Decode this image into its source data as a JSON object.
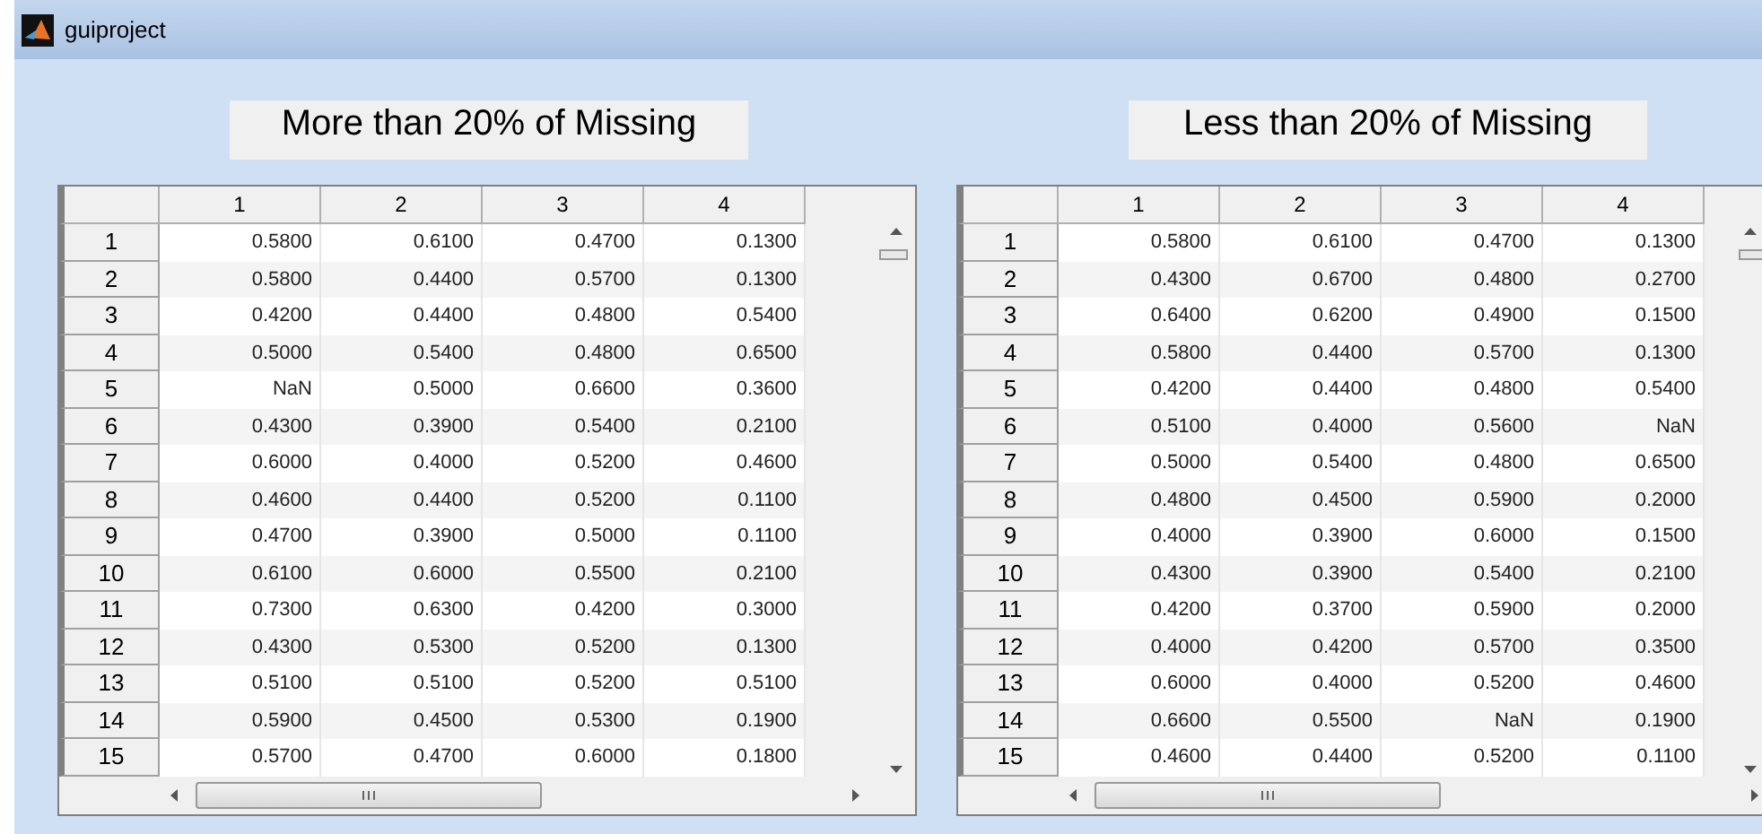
{
  "window": {
    "title": "guiproject"
  },
  "tables": [
    {
      "title": "More than 20% of Missing",
      "columns": [
        "1",
        "2",
        "3",
        "4"
      ],
      "rows": [
        {
          "label": "1",
          "cells": [
            "0.5800",
            "0.6100",
            "0.4700",
            "0.1300"
          ]
        },
        {
          "label": "2",
          "cells": [
            "0.5800",
            "0.4400",
            "0.5700",
            "0.1300"
          ]
        },
        {
          "label": "3",
          "cells": [
            "0.4200",
            "0.4400",
            "0.4800",
            "0.5400"
          ]
        },
        {
          "label": "4",
          "cells": [
            "0.5000",
            "0.5400",
            "0.4800",
            "0.6500"
          ]
        },
        {
          "label": "5",
          "cells": [
            "NaN",
            "0.5000",
            "0.6600",
            "0.3600"
          ]
        },
        {
          "label": "6",
          "cells": [
            "0.4300",
            "0.3900",
            "0.5400",
            "0.2100"
          ]
        },
        {
          "label": "7",
          "cells": [
            "0.6000",
            "0.4000",
            "0.5200",
            "0.4600"
          ]
        },
        {
          "label": "8",
          "cells": [
            "0.4600",
            "0.4400",
            "0.5200",
            "0.1100"
          ]
        },
        {
          "label": "9",
          "cells": [
            "0.4700",
            "0.3900",
            "0.5000",
            "0.1100"
          ]
        },
        {
          "label": "10",
          "cells": [
            "0.6100",
            "0.6000",
            "0.5500",
            "0.2100"
          ]
        },
        {
          "label": "11",
          "cells": [
            "0.7300",
            "0.6300",
            "0.4200",
            "0.3000"
          ]
        },
        {
          "label": "12",
          "cells": [
            "0.4300",
            "0.5300",
            "0.5200",
            "0.1300"
          ]
        },
        {
          "label": "13",
          "cells": [
            "0.5100",
            "0.5100",
            "0.5200",
            "0.5100"
          ]
        },
        {
          "label": "14",
          "cells": [
            "0.5900",
            "0.4500",
            "0.5300",
            "0.1900"
          ]
        },
        {
          "label": "15",
          "cells": [
            "0.5700",
            "0.4700",
            "0.6000",
            "0.1800"
          ]
        }
      ]
    },
    {
      "title": "Less than 20% of Missing",
      "columns": [
        "1",
        "2",
        "3",
        "4"
      ],
      "rows": [
        {
          "label": "1",
          "cells": [
            "0.5800",
            "0.6100",
            "0.4700",
            "0.1300"
          ]
        },
        {
          "label": "2",
          "cells": [
            "0.4300",
            "0.6700",
            "0.4800",
            "0.2700"
          ]
        },
        {
          "label": "3",
          "cells": [
            "0.6400",
            "0.6200",
            "0.4900",
            "0.1500"
          ]
        },
        {
          "label": "4",
          "cells": [
            "0.5800",
            "0.4400",
            "0.5700",
            "0.1300"
          ]
        },
        {
          "label": "5",
          "cells": [
            "0.4200",
            "0.4400",
            "0.4800",
            "0.5400"
          ]
        },
        {
          "label": "6",
          "cells": [
            "0.5100",
            "0.4000",
            "0.5600",
            "NaN"
          ]
        },
        {
          "label": "7",
          "cells": [
            "0.5000",
            "0.5400",
            "0.4800",
            "0.6500"
          ]
        },
        {
          "label": "8",
          "cells": [
            "0.4800",
            "0.4500",
            "0.5900",
            "0.2000"
          ]
        },
        {
          "label": "9",
          "cells": [
            "0.4000",
            "0.3900",
            "0.6000",
            "0.1500"
          ]
        },
        {
          "label": "10",
          "cells": [
            "0.4300",
            "0.3900",
            "0.5400",
            "0.2100"
          ]
        },
        {
          "label": "11",
          "cells": [
            "0.4200",
            "0.3700",
            "0.5900",
            "0.2000"
          ]
        },
        {
          "label": "12",
          "cells": [
            "0.4000",
            "0.4200",
            "0.5700",
            "0.3500"
          ]
        },
        {
          "label": "13",
          "cells": [
            "0.6000",
            "0.4000",
            "0.5200",
            "0.4600"
          ]
        },
        {
          "label": "14",
          "cells": [
            "0.6600",
            "0.5500",
            "NaN",
            "0.1900"
          ]
        },
        {
          "label": "15",
          "cells": [
            "0.4600",
            "0.4400",
            "0.5200",
            "0.1100"
          ]
        }
      ]
    }
  ]
}
